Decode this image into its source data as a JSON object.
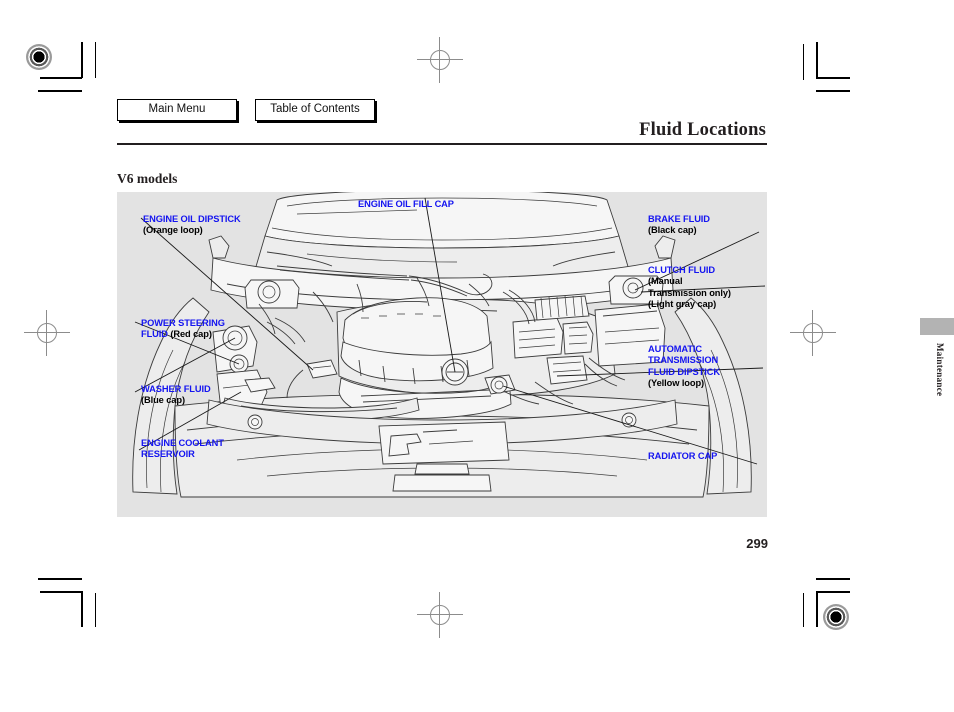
{
  "document": {
    "title": "Fluid Locations",
    "section_label": "V6 models",
    "page_number": "299",
    "side_tab_text": "Maintenance"
  },
  "nav": {
    "main_menu_label": "Main Menu",
    "table_of_contents_label": "Table of Contents"
  },
  "colors": {
    "callout_key": "#1414f0",
    "callout_sub": "#000000",
    "figure_background": "#e3e3e3",
    "rule": "#231f20",
    "side_tab_block": "#b3b3b3"
  },
  "figure": {
    "caption": "V6 models",
    "description": "Line drawing of a V6 engine bay viewed from the front of the vehicle with the hood open, showing fluid reservoir and dipstick locations.",
    "callouts": [
      {
        "id": "engine-oil-fill-cap",
        "key": "ENGINE OIL FILL CAP",
        "sub": [],
        "position": "top-center"
      },
      {
        "id": "engine-oil-dipstick",
        "key": "ENGINE OIL DIPSTICK",
        "sub": [
          "(Orange loop)"
        ],
        "position": "left"
      },
      {
        "id": "power-steering-fluid",
        "key": "POWER STEERING",
        "key2": "FLUID",
        "inline_sub": "(Red cap)",
        "sub": [],
        "position": "left"
      },
      {
        "id": "washer-fluid",
        "key": "WASHER FLUID",
        "sub": [
          "(Blue cap)"
        ],
        "position": "left"
      },
      {
        "id": "engine-coolant-reservoir",
        "key": "ENGINE COOLANT",
        "key2": "RESERVOIR",
        "sub": [],
        "position": "left"
      },
      {
        "id": "brake-fluid",
        "key": "BRAKE FLUID",
        "sub": [
          "(Black cap)"
        ],
        "position": "right"
      },
      {
        "id": "clutch-fluid",
        "key": "CLUTCH FLUID",
        "sub": [
          "(Manual",
          "Transmission only)",
          "(Light gray cap)"
        ],
        "position": "right"
      },
      {
        "id": "automatic-transmission-fluid-dipstick",
        "key": "AUTOMATIC",
        "key2": "TRANSMISSION",
        "key3": "FLUID DIPSTICK",
        "sub": [
          "(Yellow loop)"
        ],
        "position": "right"
      },
      {
        "id": "radiator-cap",
        "key": "RADIATOR CAP",
        "sub": [],
        "position": "right"
      }
    ]
  }
}
